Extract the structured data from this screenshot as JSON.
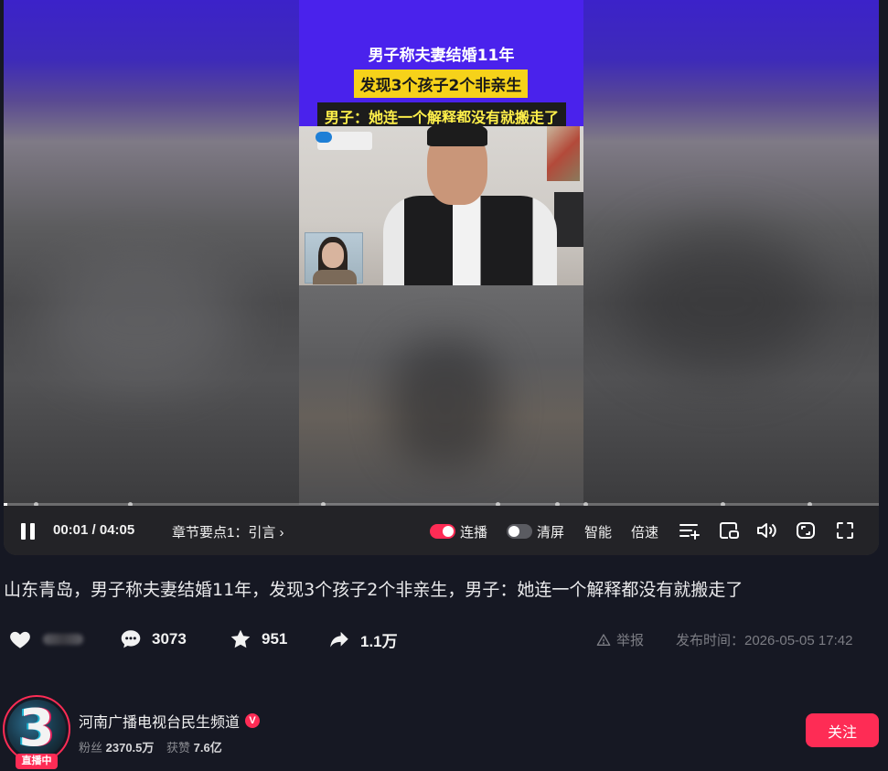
{
  "video": {
    "caption_line1": "男子称夫妻结婚11年",
    "caption_line2": "发现3个孩子2个非亲生",
    "caption_line3": "男子：她连一个解释都没有就搬走了",
    "progress_fraction": 0.004
  },
  "controls": {
    "time": "00:01 / 04:05",
    "chapter": "章节要点1：引言 ›",
    "autoplay_label": "连播",
    "autoplay_on": true,
    "clearscreen_label": "清屏",
    "clearscreen_on": false,
    "smart_label": "智能",
    "speed_label": "倍速",
    "icons": [
      "pause-icon",
      "playlist-add-icon",
      "pip-icon",
      "volume-icon",
      "webscreen-icon",
      "fullscreen-icon"
    ]
  },
  "title": "山东青岛，男子称夫妻结婚11年，发现3个孩子2个非亲生，男子：她连一个解释都没有就搬走了",
  "stats": {
    "comments": "3073",
    "favorites": "951",
    "shares": "1.1万"
  },
  "report_label": "举报",
  "publish_time": "发布时间：2026-05-05 17:42",
  "author": {
    "name": "河南广播电视台民生频道",
    "verified_mark": "V",
    "live_badge": "直播中",
    "fans_label": "粉丝",
    "fans": "2370.5万",
    "likes_label": "获赞",
    "likes": "7.6亿",
    "avatar_glyph": "3"
  },
  "follow_label": "关注",
  "colors": {
    "background": "#161823",
    "accent": "#fe2c55",
    "caption_bg": "#4a22ec",
    "caption_yellow": "#f6d21a"
  }
}
